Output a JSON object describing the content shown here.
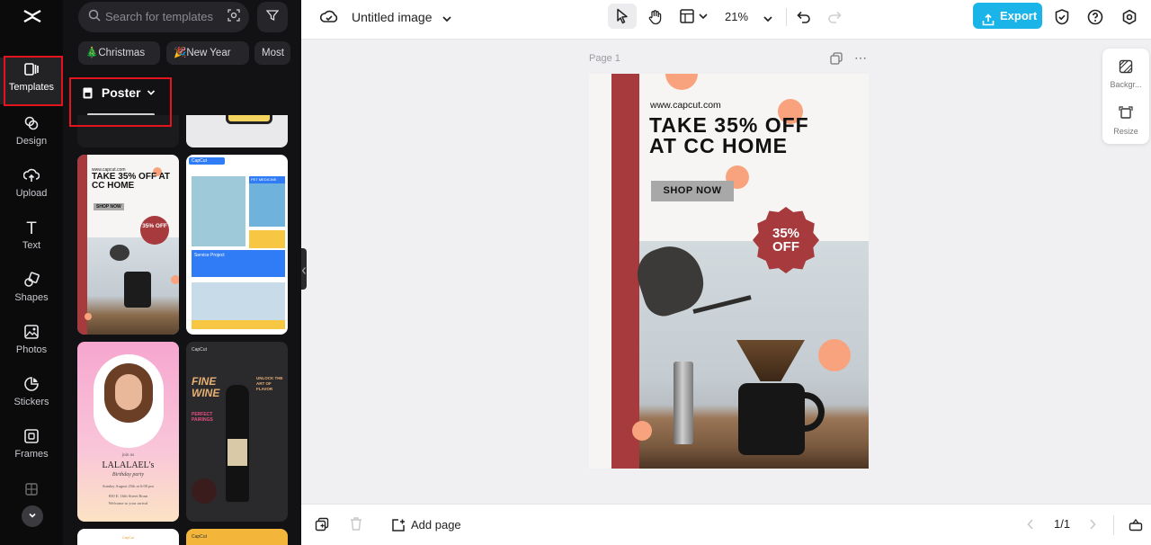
{
  "rail": {
    "items": [
      {
        "label": "Templates",
        "icon": "templates-icon"
      },
      {
        "label": "Design",
        "icon": "design-icon"
      },
      {
        "label": "Upload",
        "icon": "upload-icon"
      },
      {
        "label": "Text",
        "icon": "text-icon"
      },
      {
        "label": "Shapes",
        "icon": "shapes-icon"
      },
      {
        "label": "Photos",
        "icon": "photos-icon"
      },
      {
        "label": "Stickers",
        "icon": "stickers-icon"
      },
      {
        "label": "Frames",
        "icon": "frames-icon"
      }
    ]
  },
  "panel": {
    "search_placeholder": "Search for templates",
    "chips": [
      "🎄Christmas",
      "🎉New Year",
      "Most"
    ],
    "category": "Poster",
    "card1": {
      "url": "www.capcut.com",
      "headline": "TAKE 35% OFF AT CC HOME",
      "cta": "SHOP NOW",
      "badge": "35% OFF"
    },
    "card2": {
      "brand": "CapCut",
      "tag": "PET MEDICINE",
      "section": "Service Project"
    },
    "card3": {
      "intro": "join us",
      "name": "LALALAEL's",
      "subtitle": "Birthday party",
      "details": "Sunday August 25th at 6:00 pm",
      "address": "850 E. 16th Street Ronn",
      "welcome": "Welcome to your arrival"
    },
    "card4": {
      "brand": "CapCut",
      "title": "FINE WINE",
      "subtitle": "PERFECT PAIRINGS",
      "tagline": "UNLOCK THE ART OF FLAVOR"
    },
    "card5": {
      "brand": "CapCut"
    },
    "card6": {
      "brand": "CapCut"
    }
  },
  "topbar": {
    "title": "Untitled image",
    "zoom": "21%",
    "export_label": "Export"
  },
  "canvas": {
    "page_label": "Page 1",
    "url": "www.capcut.com",
    "headline_line1": "TAKE 35% OFF",
    "headline_line2": "AT CC HOME",
    "cta": "SHOP NOW",
    "badge_line1": "35%",
    "badge_line2": "OFF",
    "accent": "#a63a3d",
    "peach": "#f9a37e"
  },
  "side_tools": {
    "background": "Backgr...",
    "resize": "Resize"
  },
  "bottombar": {
    "add_page": "Add page",
    "page_count": "1/1"
  }
}
